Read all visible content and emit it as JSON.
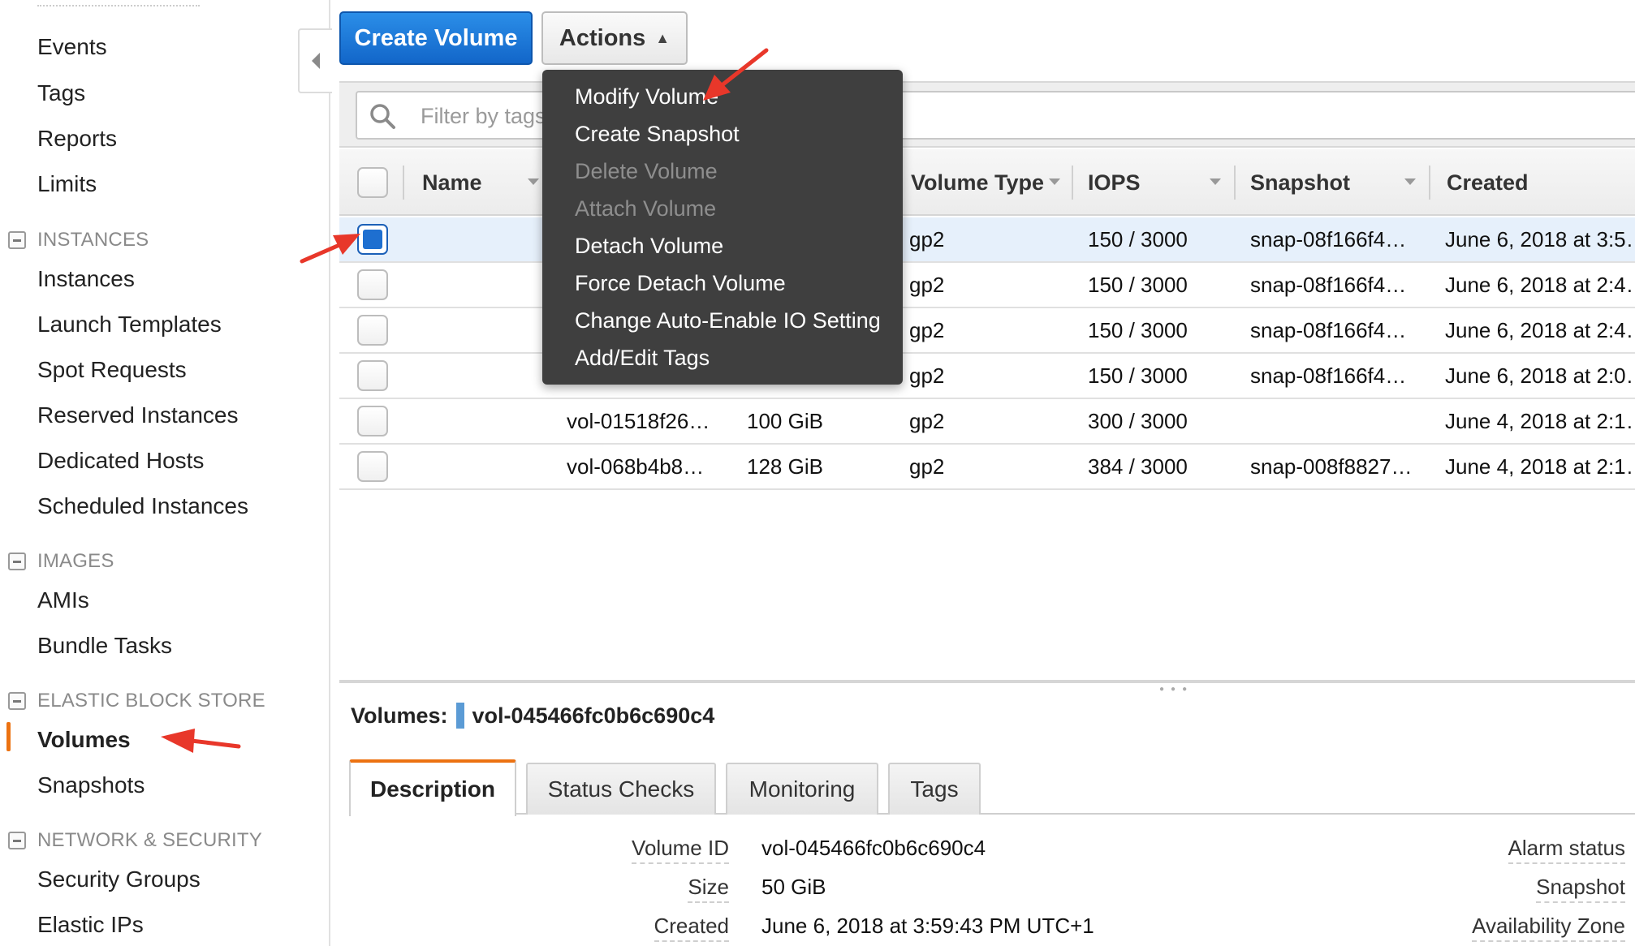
{
  "sidebar": {
    "items_top": [
      "Events",
      "Tags",
      "Reports",
      "Limits"
    ],
    "sections": [
      {
        "label": "INSTANCES",
        "items": [
          "Instances",
          "Launch Templates",
          "Spot Requests",
          "Reserved Instances",
          "Dedicated Hosts",
          "Scheduled Instances"
        ]
      },
      {
        "label": "IMAGES",
        "items": [
          "AMIs",
          "Bundle Tasks"
        ]
      },
      {
        "label": "ELASTIC BLOCK STORE",
        "items": [
          "Volumes",
          "Snapshots"
        ]
      },
      {
        "label": "NETWORK & SECURITY",
        "items": [
          "Security Groups",
          "Elastic IPs"
        ]
      }
    ],
    "active_item": "Volumes"
  },
  "toolbar": {
    "create_label": "Create Volume",
    "actions_label": "Actions"
  },
  "filter": {
    "placeholder": "Filter by tags a"
  },
  "actions_menu": {
    "items": [
      {
        "label": "Modify Volume",
        "disabled": false
      },
      {
        "label": "Create Snapshot",
        "disabled": false
      },
      {
        "label": "Delete Volume",
        "disabled": true
      },
      {
        "label": "Attach Volume",
        "disabled": true
      },
      {
        "label": "Detach Volume",
        "disabled": false
      },
      {
        "label": "Force Detach Volume",
        "disabled": false
      },
      {
        "label": "Change Auto-Enable IO Setting",
        "disabled": false
      },
      {
        "label": "Add/Edit Tags",
        "disabled": false
      }
    ]
  },
  "table": {
    "columns": [
      "Name",
      "Volume Type",
      "IOPS",
      "Snapshot",
      "Created"
    ],
    "rows": [
      {
        "selected": true,
        "volume_id": "",
        "size": "",
        "type": "gp2",
        "iops": "150 / 3000",
        "snapshot": "snap-08f166f4…",
        "created": "June 6, 2018 at 3:5…"
      },
      {
        "selected": false,
        "volume_id": "",
        "size": "",
        "type": "gp2",
        "iops": "150 / 3000",
        "snapshot": "snap-08f166f4…",
        "created": "June 6, 2018 at 2:4…"
      },
      {
        "selected": false,
        "volume_id": "",
        "size": "",
        "type": "gp2",
        "iops": "150 / 3000",
        "snapshot": "snap-08f166f4…",
        "created": "June 6, 2018 at 2:4…"
      },
      {
        "selected": false,
        "volume_id": "",
        "size": "",
        "type": "gp2",
        "iops": "150 / 3000",
        "snapshot": "snap-08f166f4…",
        "created": "June 6, 2018 at 2:0…"
      },
      {
        "selected": false,
        "volume_id": "vol-01518f26…",
        "size": "100 GiB",
        "type": "gp2",
        "iops": "300 / 3000",
        "snapshot": "",
        "created": "June 4, 2018 at 2:1…"
      },
      {
        "selected": false,
        "volume_id": "vol-068b4b8…",
        "size": "128 GiB",
        "type": "gp2",
        "iops": "384 / 3000",
        "snapshot": "snap-008f8827…",
        "created": "June 4, 2018 at 2:1…"
      }
    ]
  },
  "detail": {
    "title_label": "Volumes:",
    "title_value": "vol-045466fc0b6c690c4",
    "tabs": [
      "Description",
      "Status Checks",
      "Monitoring",
      "Tags"
    ],
    "active_tab": "Description",
    "fields": [
      {
        "label": "Volume ID",
        "value": "vol-045466fc0b6c690c4"
      },
      {
        "label": "Size",
        "value": "50 GiB"
      },
      {
        "label": "Created",
        "value": "June 6, 2018 at 3:59:43 PM UTC+1"
      }
    ],
    "right_labels": [
      "Alarm status",
      "Snapshot",
      "Availability Zone"
    ]
  },
  "colors": {
    "primary_button": "#1266c9",
    "active_accent": "#ec7211",
    "menu_bg": "#3f3f3f",
    "annotation_arrow": "#e8372a"
  },
  "icons": {
    "search": "search-icon",
    "collapse": "caret-left-icon",
    "actions_caret": "caret-up-icon"
  }
}
